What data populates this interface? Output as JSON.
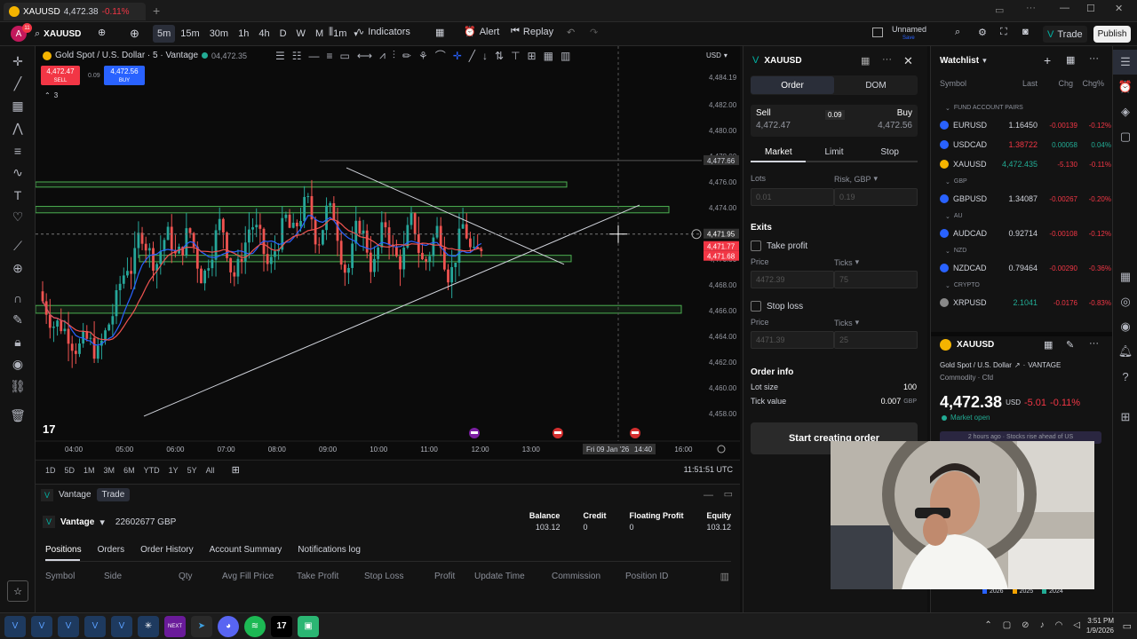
{
  "titlebar": {
    "tab_title": "XAUUSD",
    "tab_price": "4,472.38",
    "tab_change": "-0.11%"
  },
  "toolbar": {
    "symbol": "XAUUSD",
    "intervals": [
      "5m",
      "15m",
      "30m",
      "1h",
      "4h",
      "D",
      "W",
      "M",
      "1m"
    ],
    "active_interval": "5m",
    "indicators": "Indicators",
    "alert": "Alert",
    "replay": "Replay",
    "layout_name": "Unnamed",
    "layout_status": "Save",
    "trade_label": "Trade",
    "publish_label": "Publish",
    "avatar_initial": "A",
    "notif_count": "11"
  },
  "chart": {
    "legend_title": "Gold Spot / U.S. Dollar · 5 · Vantage",
    "legend_price": "04,472.35",
    "sell_price": "4,472.47",
    "sell_label": "SELL",
    "spread": "0.09",
    "buy_price": "4,472.56",
    "buy_label": "BUY",
    "indicator_count": "3",
    "currency": "USD",
    "price_ticks": [
      "4,484.19",
      "4,482.00",
      "4,480.00",
      "4,478.00",
      "4,476.00",
      "4,474.00",
      "4,472.00",
      "4,470.00",
      "4,468.00",
      "4,466.00",
      "4,464.00",
      "4,462.00",
      "4,460.00",
      "4,458.00"
    ],
    "price_tag_last": "4,477.66",
    "price_tag_cross": "4,471.95",
    "price_tag_ask": "4,471.77",
    "price_tag_bid": "4,471.68",
    "time_ticks": [
      "04:00",
      "05:00",
      "06:00",
      "07:00",
      "08:00",
      "09:00",
      "10:00",
      "11:00",
      "12:00",
      "13:00",
      "16:00"
    ],
    "crosshair_time": "Fri 09 Jan '26",
    "crosshair_clock": "14:40"
  },
  "rangebar": {
    "ranges": [
      "1D",
      "5D",
      "1M",
      "3M",
      "6M",
      "YTD",
      "1Y",
      "5Y",
      "All"
    ],
    "clock": "11:51:51 UTC"
  },
  "trade_panel": {
    "broker": "Vantage",
    "tab_trade": "Trade",
    "account_id": "22602677 GBP",
    "summary": [
      {
        "label": "Balance",
        "value": "103.12"
      },
      {
        "label": "Credit",
        "value": "0"
      },
      {
        "label": "Floating Profit",
        "value": "0"
      },
      {
        "label": "Equity",
        "value": "103.12"
      }
    ],
    "tabs": [
      "Positions",
      "Orders",
      "Order History",
      "Account Summary",
      "Notifications log"
    ],
    "columns": [
      "Symbol",
      "Side",
      "Qty",
      "Avg Fill Price",
      "Take Profit",
      "Stop Loss",
      "Profit",
      "Update Time",
      "Commission",
      "Position ID"
    ]
  },
  "order": {
    "symbol": "XAUUSD",
    "tab_order": "Order",
    "tab_dom": "DOM",
    "sell_label": "Sell",
    "sell_price": "4,472.47",
    "spread": "0.09",
    "buy_label": "Buy",
    "buy_price": "4,472.56",
    "types": [
      "Market",
      "Limit",
      "Stop"
    ],
    "lots_label": "Lots",
    "risk_label": "Risk, GBP",
    "lots_value": "0.01",
    "risk_value": "0.19",
    "exits_label": "Exits",
    "take_profit": "Take profit",
    "stop_loss": "Stop loss",
    "price_label": "Price",
    "ticks_label": "Ticks",
    "tp_price": "4472.39",
    "tp_ticks": "75",
    "sl_price": "4471.39",
    "sl_ticks": "25",
    "info_title": "Order info",
    "lot_size_label": "Lot size",
    "lot_size_value": "100",
    "tick_value_label": "Tick value",
    "tick_value_value": "0.007",
    "tick_value_ccy": "GBP",
    "submit": "Start creating order"
  },
  "watchlist": {
    "title": "Watchlist",
    "columns": [
      "Symbol",
      "Last",
      "Chg",
      "Chg%"
    ],
    "sections": [
      {
        "name": "FUND ACCOUNT PAIRS",
        "rows": [
          {
            "symbol": "EURUSD",
            "last": "1.16450",
            "chg": "-0.00139",
            "chgp": "-0.12%",
            "color": "#2962ff"
          },
          {
            "symbol": "USDCAD",
            "last": "1.38722",
            "chg": "0.00058",
            "chgp": "0.04%",
            "color": "#2962ff"
          },
          {
            "symbol": "XAUUSD",
            "last": "4,472.435",
            "chg": "-5.130",
            "chgp": "-0.11%",
            "color": "#f4b400"
          }
        ]
      },
      {
        "name": "GBP",
        "rows": [
          {
            "symbol": "GBPUSD",
            "last": "1.34087",
            "chg": "-0.00267",
            "chgp": "-0.20%",
            "color": "#2962ff"
          }
        ]
      },
      {
        "name": "AU",
        "rows": [
          {
            "symbol": "AUDCAD",
            "last": "0.92714",
            "chg": "-0.00108",
            "chgp": "-0.12%",
            "color": "#2962ff"
          }
        ]
      },
      {
        "name": "NZD",
        "rows": [
          {
            "symbol": "NZDCAD",
            "last": "0.79464",
            "chg": "-0.00290",
            "chgp": "-0.36%",
            "color": "#2962ff"
          }
        ]
      },
      {
        "name": "CRYPTO",
        "rows": [
          {
            "symbol": "XRPUSD",
            "last": "2.1041",
            "chg": "-0.0176",
            "chgp": "-0.83%",
            "color": "#888888"
          }
        ]
      }
    ],
    "detail": {
      "symbol": "XAUUSD",
      "name": "Gold Spot / U.S. Dollar",
      "exchange": "VANTAGE",
      "category": "Commodity · Cfd",
      "price": "4,472.38",
      "ccy": "USD",
      "chg": "-5.01",
      "chgp": "-0.11%",
      "status": "Market open",
      "news": "2 hours ago · Stocks rise ahead of US",
      "years": [
        "2026",
        "2025",
        "2024"
      ]
    }
  },
  "taskbar": {
    "time": "3:51 PM",
    "date": "1/9/2026"
  }
}
